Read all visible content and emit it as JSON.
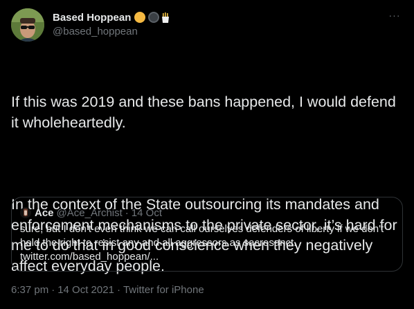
{
  "author": {
    "display_name": "Based Hoppean",
    "handle": "@based_hoppean",
    "badges": [
      "orange-circle-icon",
      "dark-circle-icon",
      "fries-icon"
    ]
  },
  "more_menu": {
    "icon": "more-dots-icon",
    "glyph": "···"
  },
  "tweet": {
    "paragraph1": "If this was 2019 and these bans happened, I would defend it wholeheartedly.",
    "paragraph2": "In the context of the State outsourcing its mandates and enforcement mechanisms to the private sector, it’s hard for me to do that in good conscience when they negatively affect everyday people."
  },
  "quote": {
    "name": "Ace",
    "handle": "@Ace_Archist",
    "separator": "·",
    "date": "14 Oct",
    "text": "sure, but I don't even think we can call ourselves defenders of liberty if we don't hold the right to resist any and all aggressors as sacrosanct.",
    "link": "twitter.com/based_hoppean/..."
  },
  "meta": {
    "time": "6:37 pm",
    "separator": "·",
    "date": "14 Oct 2021",
    "source": "Twitter for iPhone"
  },
  "colors": {
    "background": "#000000",
    "text": "#e7e9ea",
    "secondary": "#71767b",
    "border": "#2f3336"
  }
}
